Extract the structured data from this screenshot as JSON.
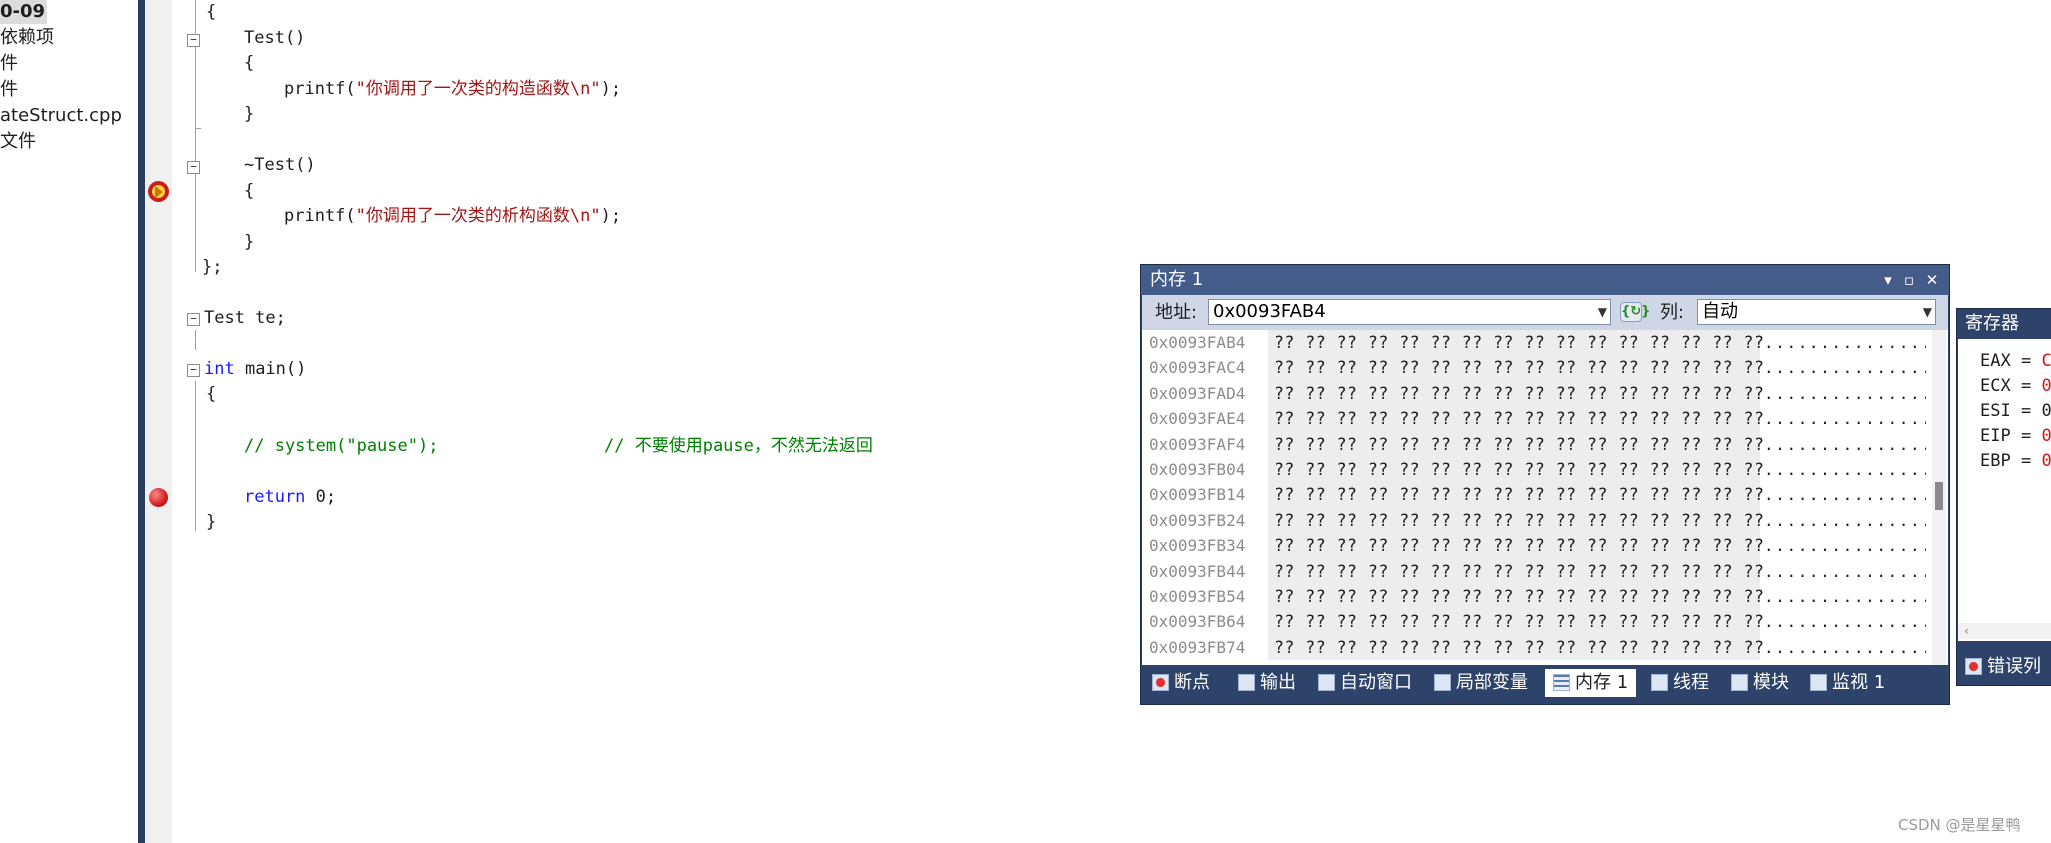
{
  "solution_explorer": {
    "items": [
      {
        "label": "0-09",
        "selected": true
      },
      {
        "label": "依赖项"
      },
      {
        "label": "件"
      },
      {
        "label": "件"
      },
      {
        "label": "ateStruct.cpp"
      },
      {
        "label": "文件"
      }
    ]
  },
  "editor": {
    "lines": [
      {
        "open": "{"
      },
      {
        "ctor": "Test()"
      },
      {
        "open": "{"
      },
      {
        "fn": "printf(",
        "str": "\"你调用了一次类的构造函数\\n\"",
        "end": ");"
      },
      {
        "close": "}"
      },
      {
        "dtor": "~Test()"
      },
      {
        "open": "{"
      },
      {
        "fn": "printf(",
        "str": "\"你调用了一次类的析构函数\\n\"",
        "end": ");"
      },
      {
        "close": "}"
      },
      {
        "close": "};"
      },
      {
        "decl": "Test te;"
      },
      {
        "kw": "int",
        "rest": " main()"
      },
      {
        "open": "{"
      },
      {
        "comment1": "// system(\"pause\");",
        "comment2": "// 不要使用pause，不然无法返回"
      },
      {
        "kw": "return",
        "rest": " 0;"
      },
      {
        "close": "}"
      }
    ],
    "current_line_indicator": "current-statement-arrow",
    "breakpoint": "breakpoint-icon"
  },
  "memory_window": {
    "title": "内存 1",
    "address_label": "地址:",
    "address_value": "0x0093FAB4",
    "columns_label": "列:",
    "columns_value": "自动",
    "rows": [
      {
        "addr": "0x0093FAB4",
        "hex": "?? ?? ?? ?? ?? ?? ?? ?? ?? ?? ?? ?? ?? ?? ?? ??",
        "ascii": "................"
      },
      {
        "addr": "0x0093FAC4",
        "hex": "?? ?? ?? ?? ?? ?? ?? ?? ?? ?? ?? ?? ?? ?? ?? ??",
        "ascii": "................"
      },
      {
        "addr": "0x0093FAD4",
        "hex": "?? ?? ?? ?? ?? ?? ?? ?? ?? ?? ?? ?? ?? ?? ?? ??",
        "ascii": "................"
      },
      {
        "addr": "0x0093FAE4",
        "hex": "?? ?? ?? ?? ?? ?? ?? ?? ?? ?? ?? ?? ?? ?? ?? ??",
        "ascii": "................"
      },
      {
        "addr": "0x0093FAF4",
        "hex": "?? ?? ?? ?? ?? ?? ?? ?? ?? ?? ?? ?? ?? ?? ?? ??",
        "ascii": "................"
      },
      {
        "addr": "0x0093FB04",
        "hex": "?? ?? ?? ?? ?? ?? ?? ?? ?? ?? ?? ?? ?? ?? ?? ??",
        "ascii": "................"
      },
      {
        "addr": "0x0093FB14",
        "hex": "?? ?? ?? ?? ?? ?? ?? ?? ?? ?? ?? ?? ?? ?? ?? ??",
        "ascii": "................"
      },
      {
        "addr": "0x0093FB24",
        "hex": "?? ?? ?? ?? ?? ?? ?? ?? ?? ?? ?? ?? ?? ?? ?? ??",
        "ascii": "................"
      },
      {
        "addr": "0x0093FB34",
        "hex": "?? ?? ?? ?? ?? ?? ?? ?? ?? ?? ?? ?? ?? ?? ?? ??",
        "ascii": "................"
      },
      {
        "addr": "0x0093FB44",
        "hex": "?? ?? ?? ?? ?? ?? ?? ?? ?? ?? ?? ?? ?? ?? ?? ??",
        "ascii": "................"
      },
      {
        "addr": "0x0093FB54",
        "hex": "?? ?? ?? ?? ?? ?? ?? ?? ?? ?? ?? ?? ?? ?? ?? ??",
        "ascii": "................"
      },
      {
        "addr": "0x0093FB64",
        "hex": "?? ?? ?? ?? ?? ?? ?? ?? ?? ?? ?? ?? ?? ?? ?? ??",
        "ascii": "................"
      },
      {
        "addr": "0x0093FB74",
        "hex": "?? ?? ?? ?? ?? ?? ?? ?? ?? ?? ?? ?? ?? ?? ?? ??",
        "ascii": "................"
      }
    ],
    "tabs": [
      {
        "label": "断点",
        "icon": "breakpoints-tab-icon"
      },
      {
        "label": "输出",
        "icon": "output-tab-icon"
      },
      {
        "label": "自动窗口",
        "icon": "autos-tab-icon"
      },
      {
        "label": "局部变量",
        "icon": "locals-tab-icon"
      },
      {
        "label": "内存 1",
        "icon": "memory-tab-icon",
        "active": true
      },
      {
        "label": "线程",
        "icon": "threads-tab-icon"
      },
      {
        "label": "模块",
        "icon": "modules-tab-icon"
      },
      {
        "label": "监视 1",
        "icon": "watch-tab-icon"
      }
    ]
  },
  "registers_window": {
    "title": "寄存器",
    "registers": [
      {
        "name": "EAX",
        "eq": " = ",
        "value": "C"
      },
      {
        "name": "ECX",
        "eq": " = ",
        "value": "0"
      },
      {
        "name": "ESI",
        "eq": " = ",
        "value": "0"
      },
      {
        "name": "EIP",
        "eq": " = ",
        "value": "0"
      },
      {
        "name": "EBP",
        "eq": " = ",
        "value": "0"
      }
    ],
    "scroll_glyph": "‹",
    "tab_label": "错误列"
  },
  "watermark": "CSDN @是星星鸭",
  "colors": {
    "keyword": "#1a1aff",
    "string": "#a31515",
    "comment": "#008000",
    "panel_frame": "#2e4369",
    "title_bar": "#445c8a"
  }
}
